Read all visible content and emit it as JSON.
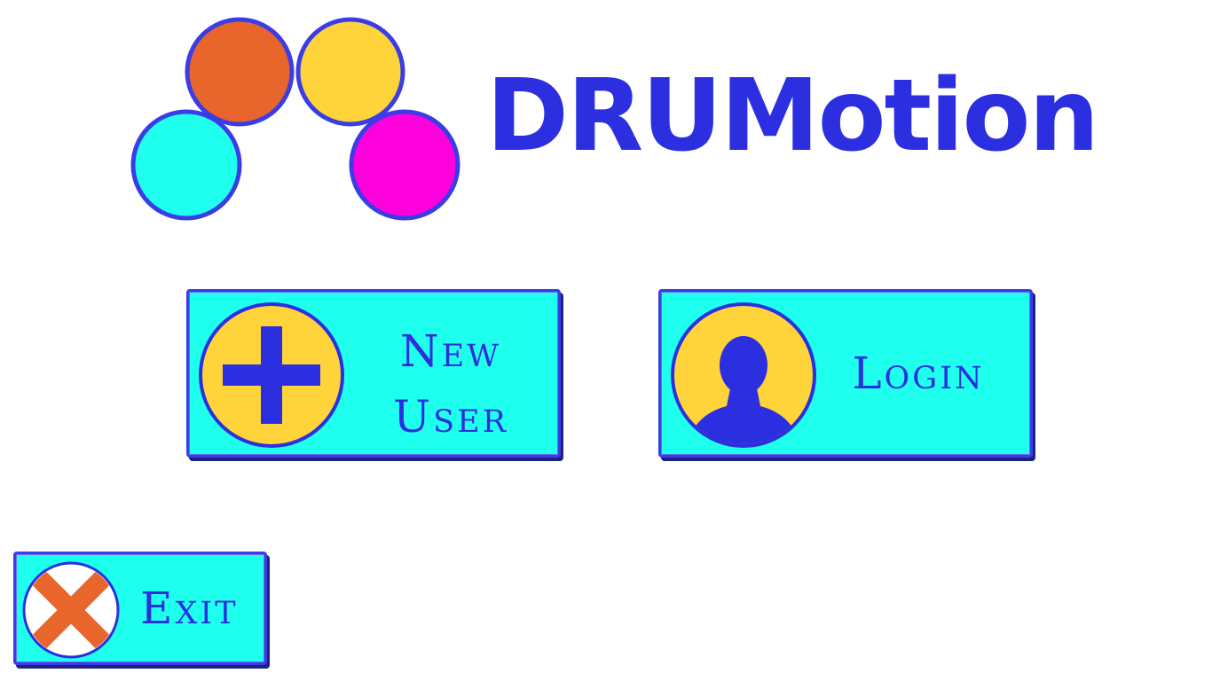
{
  "brand": {
    "name": "DRUMotion",
    "logo_circle_colors": [
      "#e8652b",
      "#ffd43b",
      "#1fffee",
      "#ff00dd"
    ],
    "accent": "#2b2fe0"
  },
  "buttons": {
    "new_user": {
      "line1": "New",
      "line2": "User",
      "icon": "plus-icon"
    },
    "login": {
      "label": "Login",
      "icon": "user-icon"
    },
    "exit": {
      "label": "Exit",
      "icon": "close-icon"
    }
  },
  "colors": {
    "button_bg": "#1fffee",
    "button_border": "#3a3de6",
    "icon_bg": "#ffd43b",
    "exit_x": "#e8652b"
  }
}
